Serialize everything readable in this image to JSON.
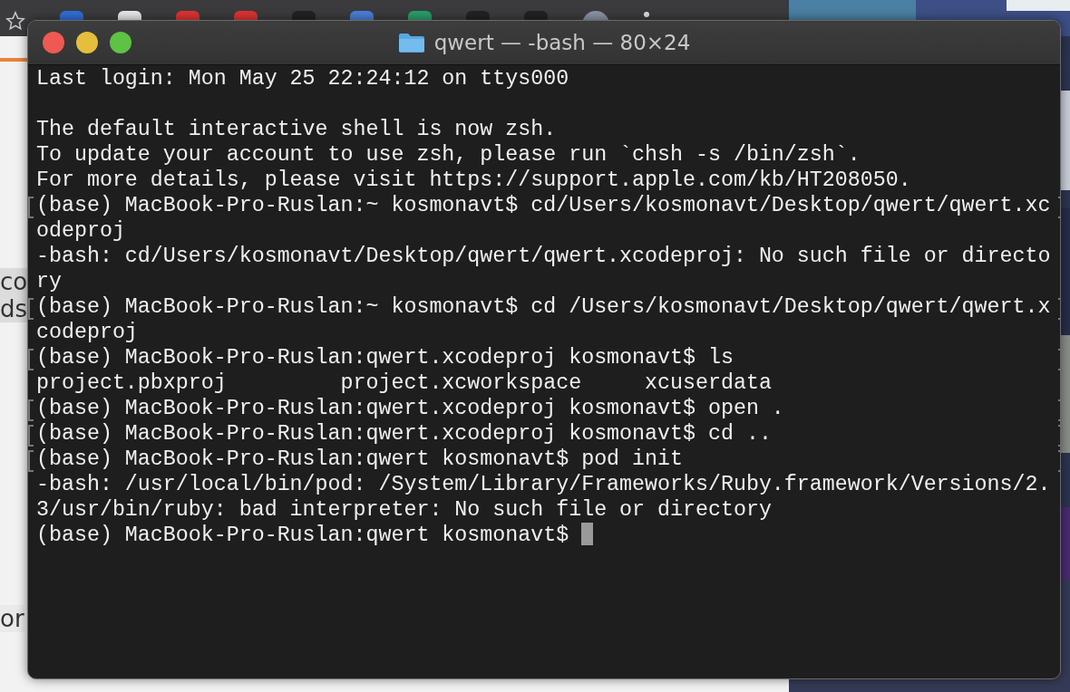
{
  "background_page": {
    "fragments": [
      "co",
      "ds",
      "or"
    ]
  },
  "window": {
    "title": "qwert — -bash — 80×24"
  },
  "terminal": {
    "cursor": true,
    "lines": [
      {
        "text": "Last login: Mon May 25 22:24:12 on ttys000",
        "marked": false
      },
      {
        "marked": false
      },
      {
        "text": "The default interactive shell is now zsh.",
        "marked": false
      },
      {
        "text": "To update your account to use zsh, please run `chsh -s /bin/zsh`.",
        "marked": false
      },
      {
        "text": "For more details, please visit https://support.apple.com/kb/HT208050.",
        "marked": false
      },
      {
        "text": "(base) MacBook-Pro-Ruslan:~ kosmonavt$ cd/Users/kosmonavt/Desktop/qwert/qwert.xc",
        "marked": true
      },
      {
        "text": "odeproj",
        "marked": false
      },
      {
        "text": "-bash: cd/Users/kosmonavt/Desktop/qwert/qwert.xcodeproj: No such file or directo",
        "marked": false
      },
      {
        "text": "ry",
        "marked": false
      },
      {
        "text": "(base) MacBook-Pro-Ruslan:~ kosmonavt$ cd /Users/kosmonavt/Desktop/qwert/qwert.x",
        "marked": true
      },
      {
        "text": "codeproj",
        "marked": false
      },
      {
        "text": "(base) MacBook-Pro-Ruslan:qwert.xcodeproj kosmonavt$ ls",
        "marked": true
      },
      {
        "text": "project.pbxproj         project.xcworkspace     xcuserdata",
        "marked": false
      },
      {
        "text": "(base) MacBook-Pro-Ruslan:qwert.xcodeproj kosmonavt$ open .",
        "marked": true
      },
      {
        "text": "(base) MacBook-Pro-Ruslan:qwert.xcodeproj kosmonavt$ cd ..",
        "marked": true
      },
      {
        "text": "(base) MacBook-Pro-Ruslan:qwert kosmonavt$ pod init",
        "marked": true
      },
      {
        "text": "-bash: /usr/local/bin/pod: /System/Library/Frameworks/Ruby.framework/Versions/2.",
        "marked": false
      },
      {
        "text": "3/usr/bin/ruby: bad interpreter: No such file or directory",
        "marked": false
      },
      {
        "text": "(base) MacBook-Pro-Ruslan:qwert kosmonavt$ ",
        "marked": false
      }
    ]
  }
}
